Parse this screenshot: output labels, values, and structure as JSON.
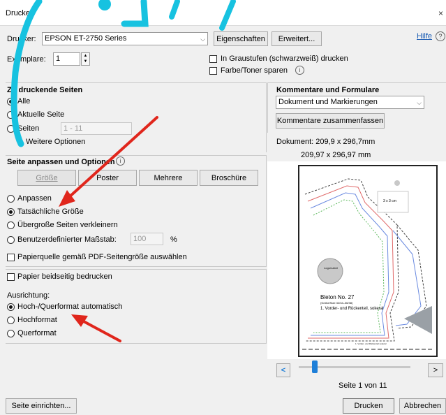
{
  "window": {
    "title": "Drucken",
    "close_glyph": "×"
  },
  "printer": {
    "label": "Drucker:",
    "value": "EPSON ET-2750 Series",
    "properties_button": "Eigenschaften",
    "advanced_button": "Erweitert...",
    "help_link": "Hilfe",
    "copies_label": "Exemplare:",
    "copies_value": "1",
    "grayscale_label": "In Graustufen (schwarzweiß) drucken",
    "save_toner_label": "Farbe/Toner sparen"
  },
  "pages_to_print": {
    "heading": "Zu druckende Seiten",
    "all": "Alle",
    "current": "Aktuelle Seite",
    "pages": "Seiten",
    "pages_value": "1 - 11",
    "more_options": "Weitere Optionen"
  },
  "size": {
    "heading": "Seite anpassen und Optionen",
    "tabs": [
      "Größe",
      "Poster",
      "Mehrere",
      "Broschüre"
    ],
    "fit": "Anpassen",
    "actual": "Tatsächliche Größe",
    "shrink": "Übergroße Seiten verkleinern",
    "custom": "Benutzerdefinierter Maßstab:",
    "custom_value": "100",
    "percent": "%",
    "paper_source": "Papierquelle gemäß PDF-Seitengröße auswählen"
  },
  "duplex": {
    "label": "Papier beidseitig bedrucken"
  },
  "orientation": {
    "heading": "Ausrichtung:",
    "auto": "Hoch-/Querformat automatisch",
    "portrait": "Hochformat",
    "landscape": "Querformat"
  },
  "comments": {
    "heading": "Kommentare und Formulare",
    "select_value": "Dokument und Markierungen",
    "summarize_button": "Kommentare zusammenfassen"
  },
  "preview": {
    "document_size": "Dokument: 209,9 x 296,7mm",
    "page_size": "209,97 x 296,97 mm",
    "page_status": "Seite 1 von 11",
    "pattern_text_1": "Bleton No. 27",
    "pattern_text_2": "1. Vorder- und Rückenteil, sokeral",
    "pattern_small": "(Größe/Size 32/34–36/38)",
    "circle_text": "Logo/Label",
    "square_text": "3 x 3 cm",
    "footer_text": "1. Vorder- und Rückenteil sokeral",
    "prev_glyph": "<",
    "next_glyph": ">"
  },
  "footer": {
    "page_setup_button": "Seite einrichten...",
    "print_button": "Drucken",
    "cancel_button": "Abbrechen"
  },
  "colors": {
    "accent_blue": "#1e7fd8",
    "annotation_cyan": "#17c2e0",
    "arrow_red": "#e0261c"
  },
  "icons": [
    "help-icon",
    "info-icon",
    "chevron-down-icon",
    "spin-up-icon",
    "spin-down-icon",
    "triangle-right-icon",
    "close-icon"
  ]
}
